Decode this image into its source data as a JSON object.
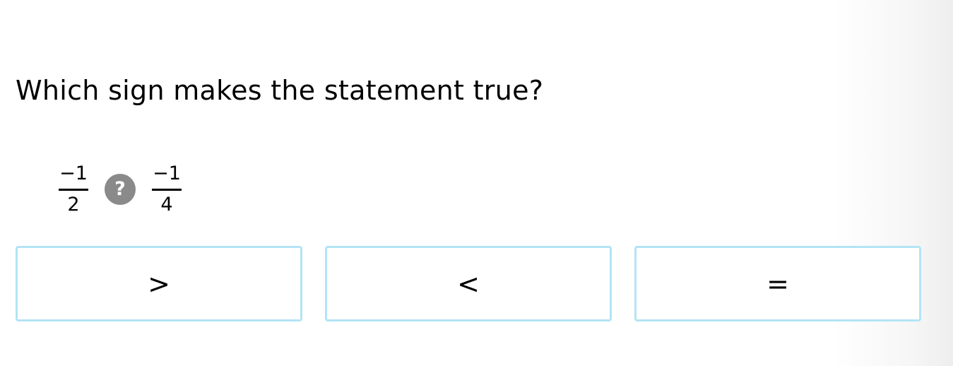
{
  "question": {
    "prompt": "Which sign makes the statement true?"
  },
  "expression": {
    "left": {
      "numerator": "−1",
      "denominator": "2"
    },
    "unknown_symbol": "?",
    "right": {
      "numerator": "−1",
      "denominator": "4"
    }
  },
  "choices": [
    {
      "label": ">"
    },
    {
      "label": "<"
    },
    {
      "label": "="
    }
  ],
  "colors": {
    "choice_border": "#b3e4f5",
    "unknown_badge": "#8a8a8a"
  },
  "icons": {
    "unknown": "question-mark-icon"
  }
}
